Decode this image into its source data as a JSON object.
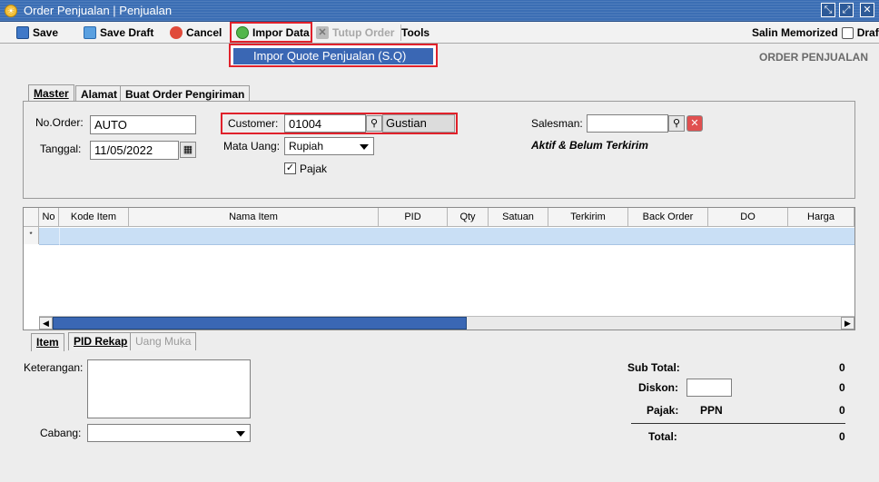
{
  "window": {
    "title": "Order Penjualan | Penjualan",
    "controls": [
      "restore-icon",
      "maximize-icon",
      "close-icon"
    ]
  },
  "toolbar": {
    "save": "Save",
    "save_draft": "Save Draft",
    "cancel": "Cancel",
    "import_data": "Impor Data",
    "close_order": "Tutup Order",
    "tools": "Tools",
    "memorized": "Salin Memorized",
    "draft": "Draft"
  },
  "import_menu": {
    "items": [
      "Impor Quote Penjualan (S.Q)"
    ]
  },
  "page_heading": "ORDER PENJUALAN",
  "tabs_top": [
    "Master",
    "Alamat",
    "Buat Order Pengiriman"
  ],
  "master": {
    "order_no_label": "No.Order:",
    "order_no_value": "AUTO",
    "date_label": "Tanggal:",
    "date_value": "11/05/2022",
    "customer_label": "Customer:",
    "customer_code": "01004",
    "customer_name": "Gustian",
    "currency_label": "Mata Uang:",
    "currency_value": "Rupiah",
    "tax_label": "Pajak",
    "tax_checked": true,
    "salesman_label": "Salesman:",
    "salesman_value": "",
    "status": "Aktif & Belum Terkirim"
  },
  "grid": {
    "columns": [
      "No",
      "Kode Item",
      "Nama Item",
      "PID",
      "Qty",
      "Satuan",
      "Terkirim",
      "Back Order",
      "DO",
      "Harga"
    ],
    "rows": [
      [
        "",
        "",
        "",
        "",
        "",
        "",
        "",
        "",
        "",
        ""
      ]
    ]
  },
  "tabs_bottom": [
    "Item",
    "PID Rekap",
    "Uang Muka"
  ],
  "footer": {
    "notes_label": "Keterangan:",
    "branch_label": "Cabang:",
    "branch_value": "",
    "subtotal_label": "Sub Total:",
    "subtotal_value": "0",
    "discount_label": "Diskon:",
    "discount_input": "",
    "discount_value": "0",
    "tax_label": "Pajak:",
    "tax_name": "PPN",
    "tax_value": "0",
    "total_label": "Total:",
    "total_value": "0"
  },
  "colors": {
    "titlebar": "#3b6eb4",
    "highlight_box": "#e0212b",
    "menu_selected": "#3a67b4",
    "grid_selected_row": "#c9dff5"
  }
}
